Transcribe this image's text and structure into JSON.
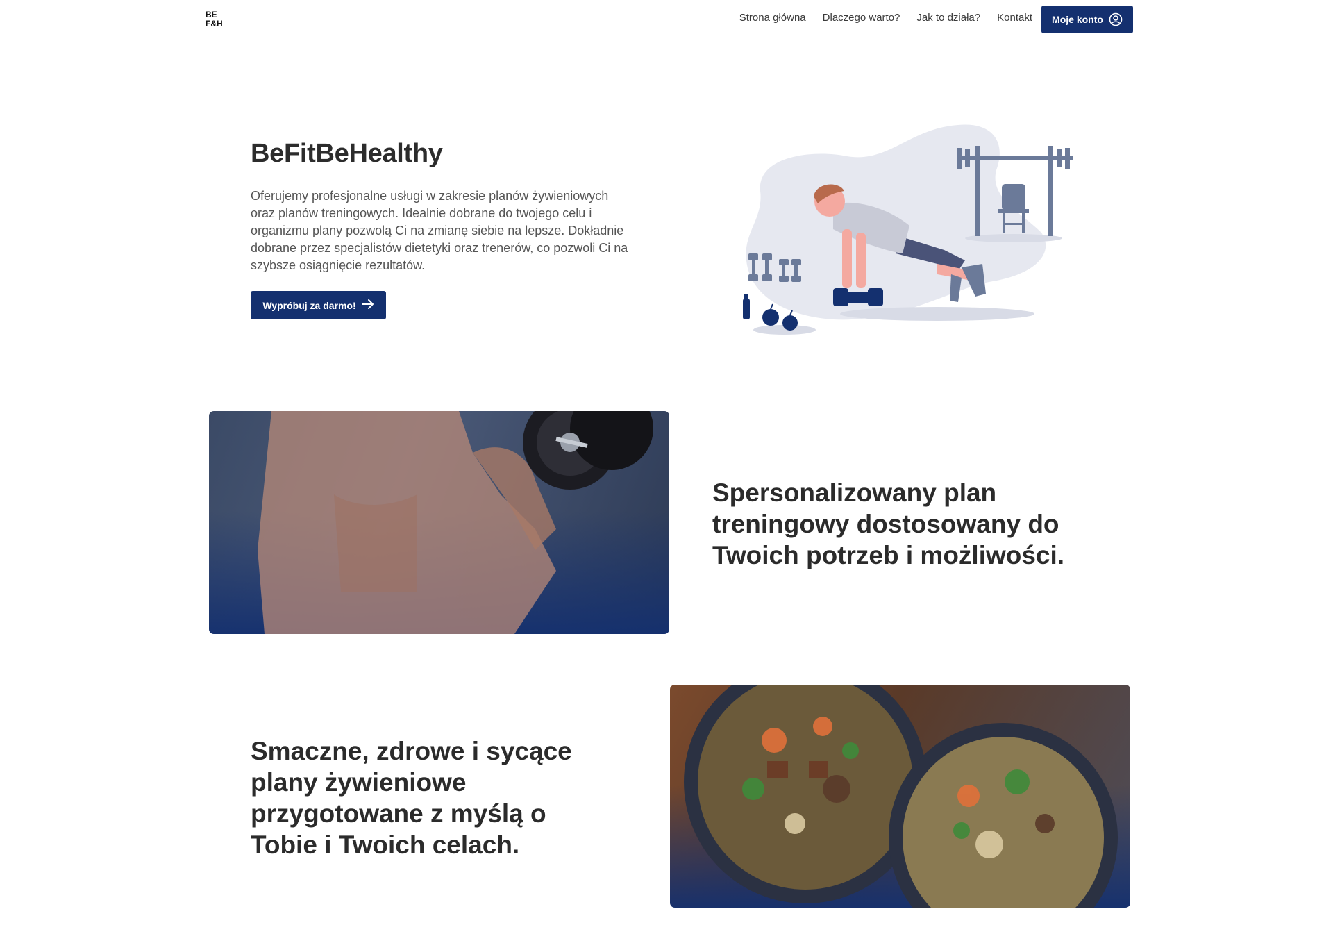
{
  "navbar": {
    "logo_line1": "BE",
    "logo_line2": "F&H",
    "links": [
      {
        "label": "Strona główna"
      },
      {
        "label": "Dlaczego warto?"
      },
      {
        "label": "Jak to działa?"
      },
      {
        "label": "Kontakt"
      }
    ],
    "account_label": "Moje konto",
    "account_icon": "user-circle-icon"
  },
  "hero": {
    "title": "BeFitBeHealthy",
    "description": "Oferujemy profesjonalne usługi w zakresie planów żywieniowych oraz planów treningowych. Idealnie dobrane do twojego celu i organizmu plany pozwolą Ci na zmianę siebie na lepsze. Dokładnie dobrane przez specjalistów dietetyki oraz trenerów, co pozwoli Ci na szybsze osiągnięcie rezultatów.",
    "cta_label": "Wypróbuj za darmo!",
    "cta_icon": "arrow-right-icon"
  },
  "features": {
    "training_heading": "Spersonalizowany plan treningowy dostosowany do Twoich potrzeb i możliwości.",
    "nutrition_heading": "Smaczne, zdrowe i sycące plany żywieniowe przygotowane z myślą o Tobie i Twoich celach."
  },
  "colors": {
    "primary": "#14306f",
    "text_dark": "#2b2b2b",
    "text_body": "#555555",
    "background": "#ffffff",
    "illustration_accent": "#6b7a99"
  }
}
